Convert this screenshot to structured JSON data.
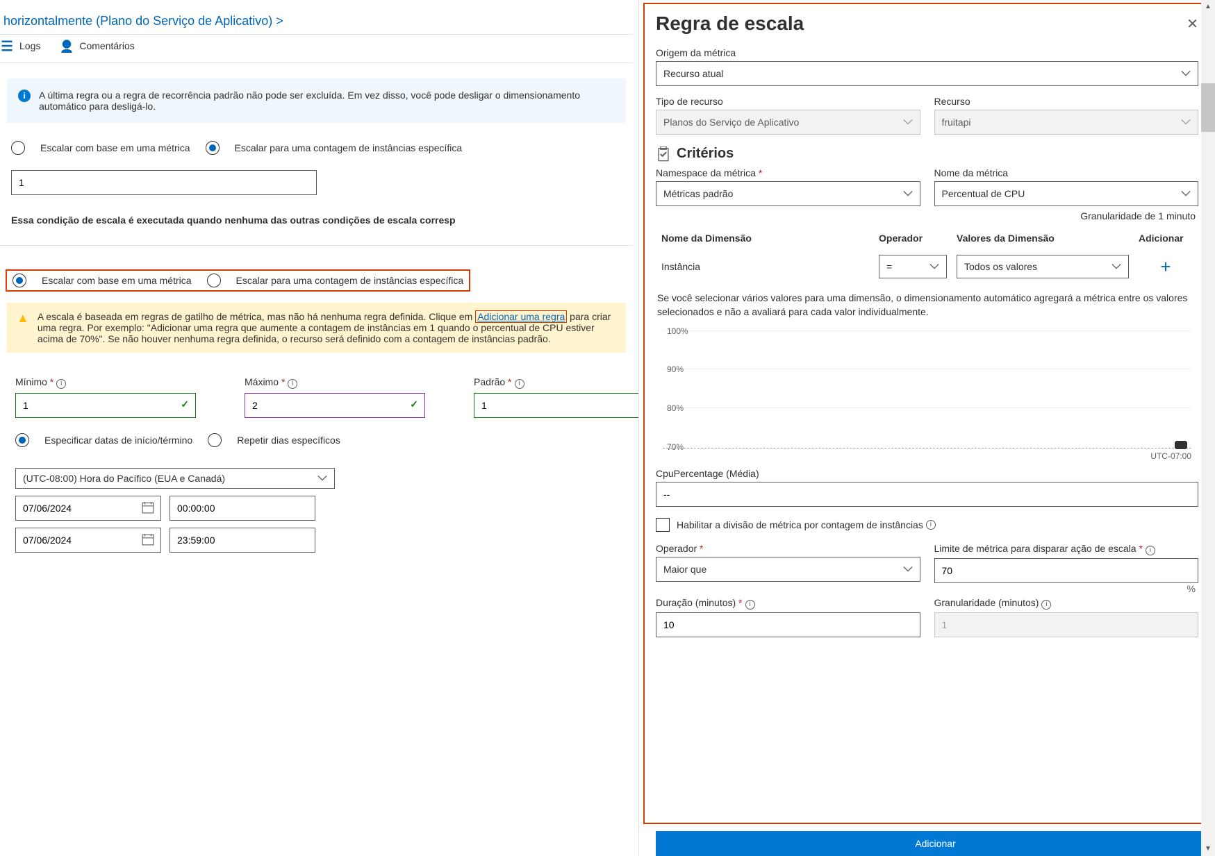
{
  "breadcrumb": "alar horizontalmente (Plano do Serviço de Aplicativo)   >",
  "toolbar": {
    "logs": "Logs",
    "comments": "Comentários"
  },
  "info_box": "A última regra ou a regra de recorrência padrão não pode ser excluída. Em vez disso, você pode desligar o dimensionamento automático para desligá-lo.",
  "scale_mode": {
    "metric": "Escalar com base em uma métrica",
    "count": "Escalar para uma contagem de instâncias específica"
  },
  "instance_count": "1",
  "cond_msg": "Essa condição de escala é executada quando nenhuma das outras condições de escala corresp",
  "warn_box": {
    "pre": "A escala é baseada em regras de gatilho de métrica, mas não há nenhuma regra definida. Clique em ",
    "link": "Adicionar uma regra",
    "post": " para criar uma regra. Por exemplo: \"Adicionar uma regra que aumente a contagem de instâncias em 1 quando o percentual de CPU estiver acima de 70%\". Se não houver nenhuma regra definida, o recurso será definido com a contagem de instâncias padrão."
  },
  "limits": {
    "min_lbl": "Mínimo",
    "min": "1",
    "max_lbl": "Máximo",
    "max": "2",
    "def_lbl": "Padrão",
    "def": "1"
  },
  "schedule": {
    "specific": "Especificar datas de início/término",
    "repeat": "Repetir dias específicos",
    "tz": "(UTC-08:00) Hora do Pacífico (EUA e Canadá)",
    "start_date": "07/06/2024",
    "start_time": "00:00:00",
    "end_date": "07/06/2024",
    "end_time": "23:59:00"
  },
  "panel": {
    "title": "Regra de escala",
    "source_lbl": "Origem da métrica",
    "source": "Recurso atual",
    "res_type_lbl": "Tipo de recurso",
    "res_type": "Planos do Serviço de Aplicativo",
    "resource_lbl": "Recurso",
    "resource": "fruitapi",
    "criteria": "Critérios",
    "ns_lbl": "Namespace da métrica",
    "ns": "Métricas padrão",
    "mname_lbl": "Nome da métrica",
    "mname": "Percentual de CPU",
    "gran": "Granularidade de 1 minuto",
    "dim_head": {
      "name": "Nome da Dimensão",
      "op": "Operador",
      "vals": "Valores da Dimensão",
      "add": "Adicionar"
    },
    "dim_row": {
      "name": "Instância",
      "op": "=",
      "vals": "Todos os valores"
    },
    "agg_note": "Se você selecionar vários valores para uma dimensão, o dimensionamento automático agregará a métrica entre os valores selecionados e não a avaliará para cada valor individualmente.",
    "tz": "UTC-07:00",
    "cpu_lbl": "CpuPercentage (Média)",
    "cpu_val": "--",
    "split_lbl": "Habilitar a divisão de métrica por contagem de instâncias",
    "op_lbl": "Operador",
    "op": "Maior que",
    "thresh_lbl": "Limite de métrica para disparar ação de escala",
    "thresh": "70",
    "pct": "%",
    "dur_lbl": "Duração (minutos)",
    "dur": "10",
    "gran2_lbl": "Granularidade (minutos)",
    "gran2": "1",
    "add_btn": "Adicionar"
  },
  "chart_data": {
    "type": "line",
    "y_ticks": [
      "100%",
      "90%",
      "80%",
      "70%"
    ],
    "ylim": [
      70,
      100
    ],
    "series": [
      {
        "name": "CpuPercentage",
        "values": []
      }
    ]
  }
}
